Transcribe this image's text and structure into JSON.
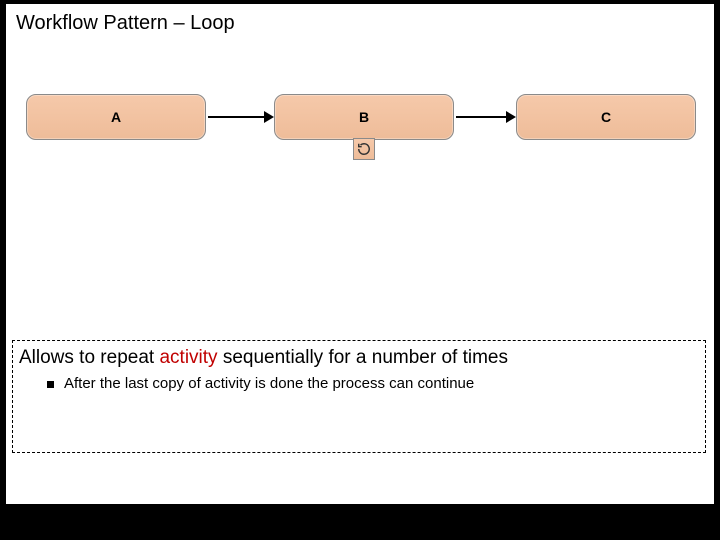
{
  "title": "Workflow Pattern – Loop",
  "nodes": {
    "a": "A",
    "b": "B",
    "c": "C"
  },
  "icon_names": {
    "loop": "loop-icon"
  },
  "desc": {
    "prefix": "Allows to repeat ",
    "highlight": "activity",
    "suffix": " sequentially for a number of times",
    "bullet": "After the last copy of activity is done the process can continue"
  }
}
